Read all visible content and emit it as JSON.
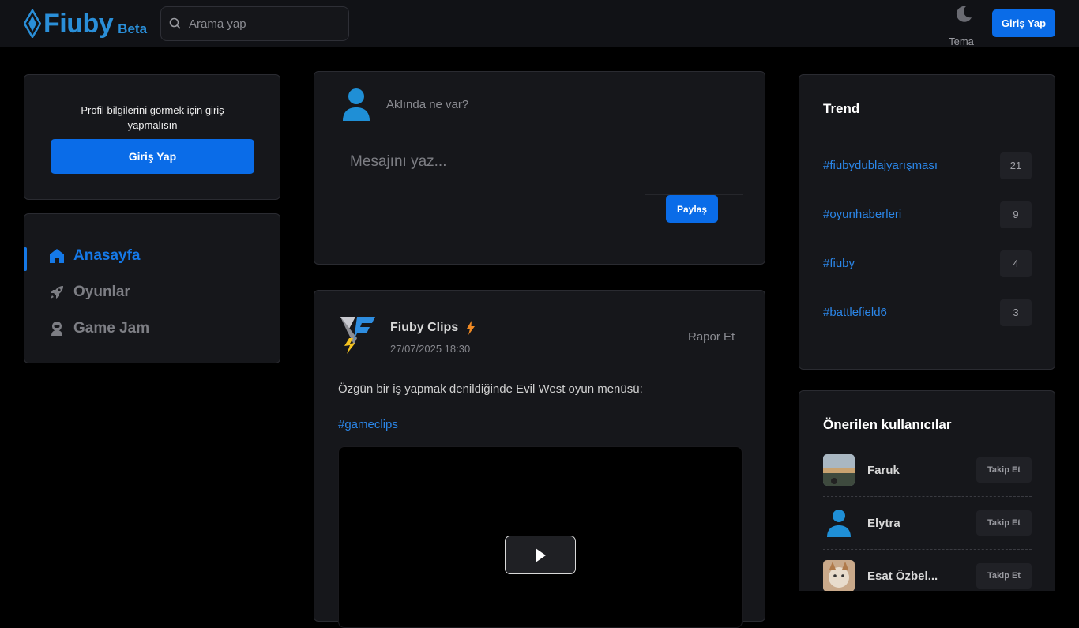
{
  "header": {
    "logo_text": "Fiuby",
    "logo_badge": "Beta",
    "search_placeholder": "Arama yap",
    "theme_label": "Tema",
    "login_label": "Giriş Yap",
    "accent_color": "#0a6ce8"
  },
  "profile": {
    "message": "Profil bilgilerini görmek için giriş yapmalısın",
    "login_label": "Giriş Yap"
  },
  "nav": {
    "items": [
      {
        "label": "Anasayfa",
        "icon": "home-icon",
        "active": true
      },
      {
        "label": "Oyunlar",
        "icon": "rocket-icon",
        "active": false
      },
      {
        "label": "Game Jam",
        "icon": "astronaut-icon",
        "active": false
      }
    ]
  },
  "composer": {
    "prompt": "Aklında ne var?",
    "placeholder": "Mesajını yaz...",
    "share_label": "Paylaş"
  },
  "post": {
    "author": "Fiuby Clips",
    "date": "27/07/2025 18:30",
    "report_label": "Rapor Et",
    "text": "Özgün bir iş yapmak denildiğinde Evil West oyun menüsü:",
    "hashtag": "#gameclips"
  },
  "trend": {
    "title": "Trend",
    "items": [
      {
        "tag": "#fiubydublajyarışması",
        "count": "21"
      },
      {
        "tag": "#oyunhaberleri",
        "count": "9"
      },
      {
        "tag": "#fiuby",
        "count": "4"
      },
      {
        "tag": "#battlefield6",
        "count": "3"
      },
      {
        "tag": "",
        "count": ""
      }
    ]
  },
  "suggested": {
    "title": "Önerilen kullanıcılar",
    "follow_label": "Takip Et",
    "users": [
      {
        "name": "Faruk",
        "avatar": "landscape-photo"
      },
      {
        "name": "Elytra",
        "avatar": "default-user-icon"
      },
      {
        "name": "Esat Özbel...",
        "avatar": "cat-photo"
      }
    ]
  }
}
